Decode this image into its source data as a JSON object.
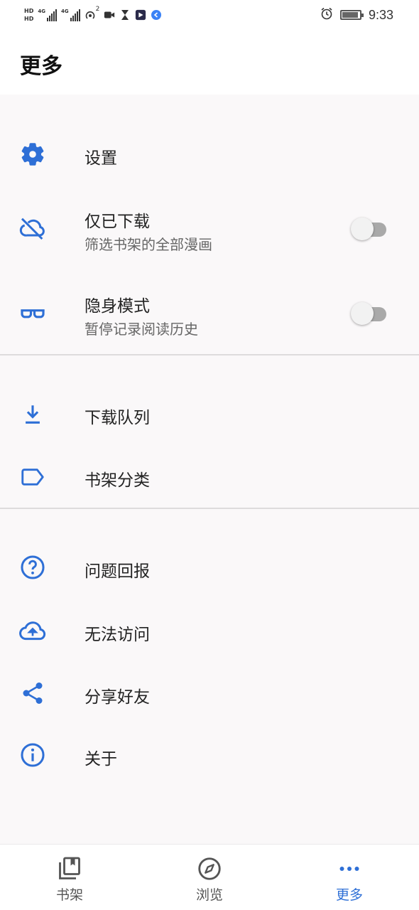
{
  "status_bar": {
    "hd1": "HD",
    "hd2": "HD",
    "net1": "4G",
    "net2": "4G",
    "hotspot_count": "2",
    "time": "9:33"
  },
  "header": {
    "title": "更多"
  },
  "menu": {
    "settings": {
      "label": "设置",
      "icon": "gear-icon"
    },
    "downloaded_only": {
      "label": "仅已下载",
      "subtitle": "筛选书架的全部漫画",
      "icon": "cloud-off-icon",
      "toggle_on": false
    },
    "incognito": {
      "label": "隐身模式",
      "subtitle": "暂停记录阅读历史",
      "icon": "glasses-icon",
      "toggle_on": false
    },
    "download_queue": {
      "label": "下载队列",
      "icon": "download-icon"
    },
    "categories": {
      "label": "书架分类",
      "icon": "label-icon"
    },
    "feedback": {
      "label": "问题回报",
      "icon": "help-circle-icon"
    },
    "cannot_access": {
      "label": "无法访问",
      "icon": "cloud-upload-icon"
    },
    "share": {
      "label": "分享好友",
      "icon": "share-icon"
    },
    "about": {
      "label": "关于",
      "icon": "info-icon"
    }
  },
  "bottom_nav": {
    "items": [
      {
        "label": "书架",
        "icon": "library-icon",
        "active": false
      },
      {
        "label": "浏览",
        "icon": "compass-icon",
        "active": false
      },
      {
        "label": "更多",
        "icon": "more-dots-icon",
        "active": true
      }
    ]
  },
  "colors": {
    "accent": "#2e6fd6",
    "background": "#faf8f9",
    "toggle_track_off": "#a9a9a9"
  }
}
